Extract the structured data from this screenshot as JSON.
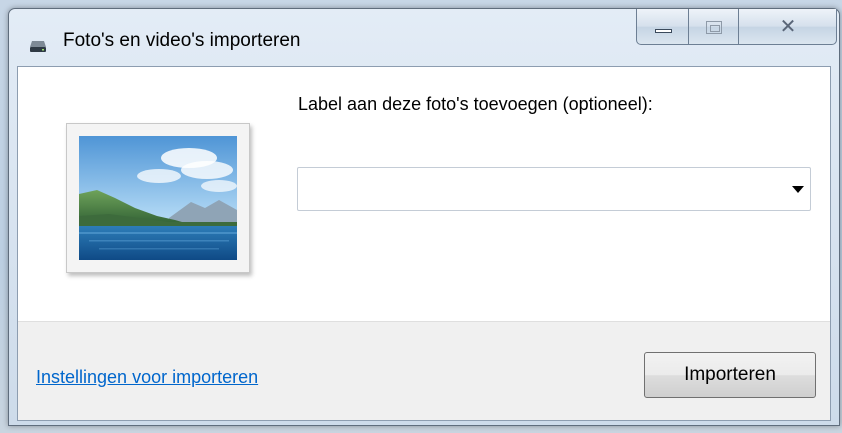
{
  "window": {
    "title": "Foto's en video's importeren",
    "title_icon": "drive-icon",
    "caption_buttons": [
      "minimize-icon",
      "maximize-icon",
      "close-icon"
    ]
  },
  "main": {
    "thumbnail_icon": "landscape-photo-icon",
    "tag_label": "Label aan deze foto's toevoegen (optioneel):",
    "tag_value": ""
  },
  "footer": {
    "settings_link": "Instellingen voor importeren",
    "import_button": "Importeren"
  },
  "colors": {
    "link": "#0066cc",
    "footer_bg": "#f0f0f0"
  }
}
